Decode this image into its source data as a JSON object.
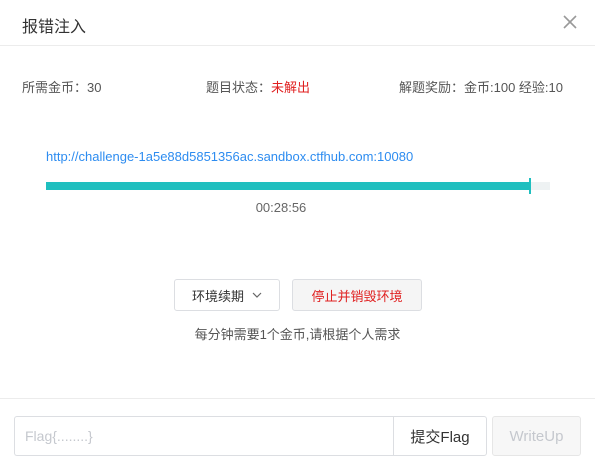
{
  "dialog": {
    "title": "报错注入",
    "close_icon": "close-icon"
  },
  "info": {
    "cost_label": "所需金币：30",
    "status_label": "题目状态：",
    "status_value": "未解出",
    "status_color": "#e02020",
    "reward_label": "解题奖励：金币:100 经验:10"
  },
  "environment": {
    "url": "http://challenge-1a5e88d5851356ac.sandbox.ctfhub.com:10080",
    "progress_fraction": 0.96,
    "accent_color": "#1fbfbf",
    "remaining_time": "00:28:56"
  },
  "actions": {
    "extend_label": "环境续期",
    "extend_icon": "chevron-down-icon",
    "destroy_label": "停止并销毁环境",
    "note": "每分钟需要1个金币,请根据个人需求"
  },
  "footer": {
    "flag_placeholder": "Flag{........}",
    "submit_label": "提交Flag",
    "writeup_label": "WriteUp"
  }
}
